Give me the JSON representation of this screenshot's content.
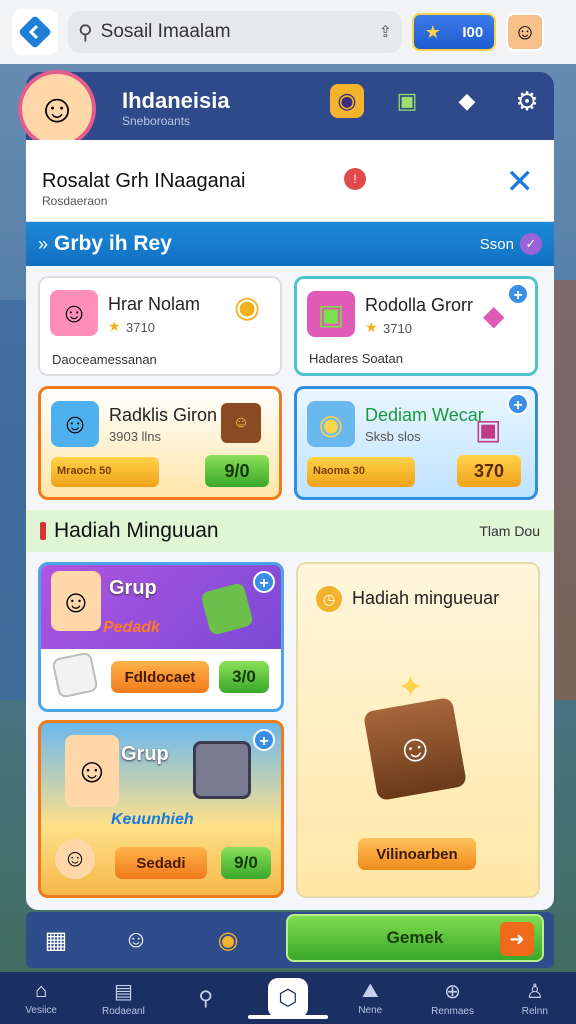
{
  "topbar": {
    "search_text": "Sosail Imaalam",
    "coins": "I00"
  },
  "header": {
    "title": "Ihdaneisia",
    "subtitle": "Sneboroants"
  },
  "user": {
    "name": "Rosalat Grh INaaganai",
    "sub": "Rosdaeraon"
  },
  "section1": {
    "title": "Grby ih Rey",
    "right": "Sson"
  },
  "cards_top": [
    {
      "name": "Hrar Nolam",
      "score": "3710",
      "desc": "Daoceamessanan"
    },
    {
      "name": "Rodolla Grorr",
      "score": "3710",
      "desc": "Hadares Soatan"
    },
    {
      "name": "Radklis Giron",
      "score": "3903 llns",
      "bar": "Mraoch 50",
      "value": "9/0"
    },
    {
      "name": "Dediam Wecar",
      "score": "Sksb slos",
      "bar": "Naoma 30",
      "value": "370"
    }
  ],
  "section2": {
    "title": "Hadiah Minguuan",
    "right": "Tlam Dou"
  },
  "group_cards": [
    {
      "label": "Grup",
      "banner": "Pedadk",
      "button": "Fdldocaet",
      "value": "3/0"
    },
    {
      "label": "Grup",
      "banner": "Keuunhieh",
      "button": "Sedadi",
      "value": "9/0"
    }
  ],
  "weekly_card": {
    "title": "Hadiah mingueuar",
    "button": "Vilinoarben"
  },
  "action_row": {
    "button": "Gemek"
  },
  "nav": [
    {
      "label": "Vesiice"
    },
    {
      "label": "Rodaeanl"
    },
    {
      "label": ""
    },
    {
      "label": ""
    },
    {
      "label": "Nene"
    },
    {
      "label": "Renmaes"
    },
    {
      "label": "Relnn"
    }
  ],
  "colors": {
    "accent": "#1e88d8",
    "header": "#2e4a8a",
    "nav": "#1c2f63",
    "green": "#3aa82a",
    "orange": "#f06a1c"
  }
}
